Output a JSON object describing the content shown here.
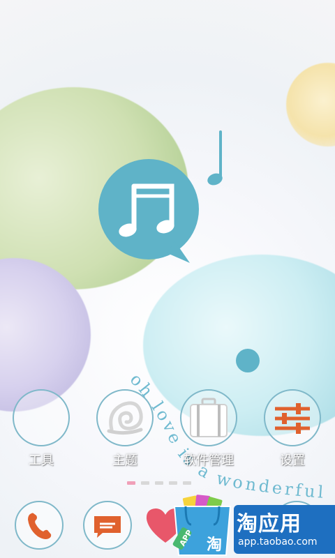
{
  "home": {
    "decor_text": "oh love is a wonderful t",
    "apps": [
      {
        "label": "工具",
        "icon": "empty-circle-icon"
      },
      {
        "label": "主题",
        "icon": "spiral-shell-icon"
      },
      {
        "label": "软件管理",
        "icon": "suitcase-icon"
      },
      {
        "label": "设置",
        "icon": "sliders-icon"
      }
    ],
    "pager": {
      "pages": 5,
      "current": 1
    }
  },
  "dock": [
    {
      "icon": "phone-icon"
    },
    {
      "icon": "message-icon"
    },
    {
      "icon": "heart-icon"
    },
    {
      "icon": "circle-icon"
    }
  ],
  "banner": {
    "title": "淘应用",
    "url": "app.taobao.com",
    "bag_label": "APP",
    "bag_glyph": "淘"
  },
  "colors": {
    "accent_blue": "#5fb3c8",
    "icon_orange": "#e0612e",
    "banner_blue": "#1e6fc0"
  }
}
